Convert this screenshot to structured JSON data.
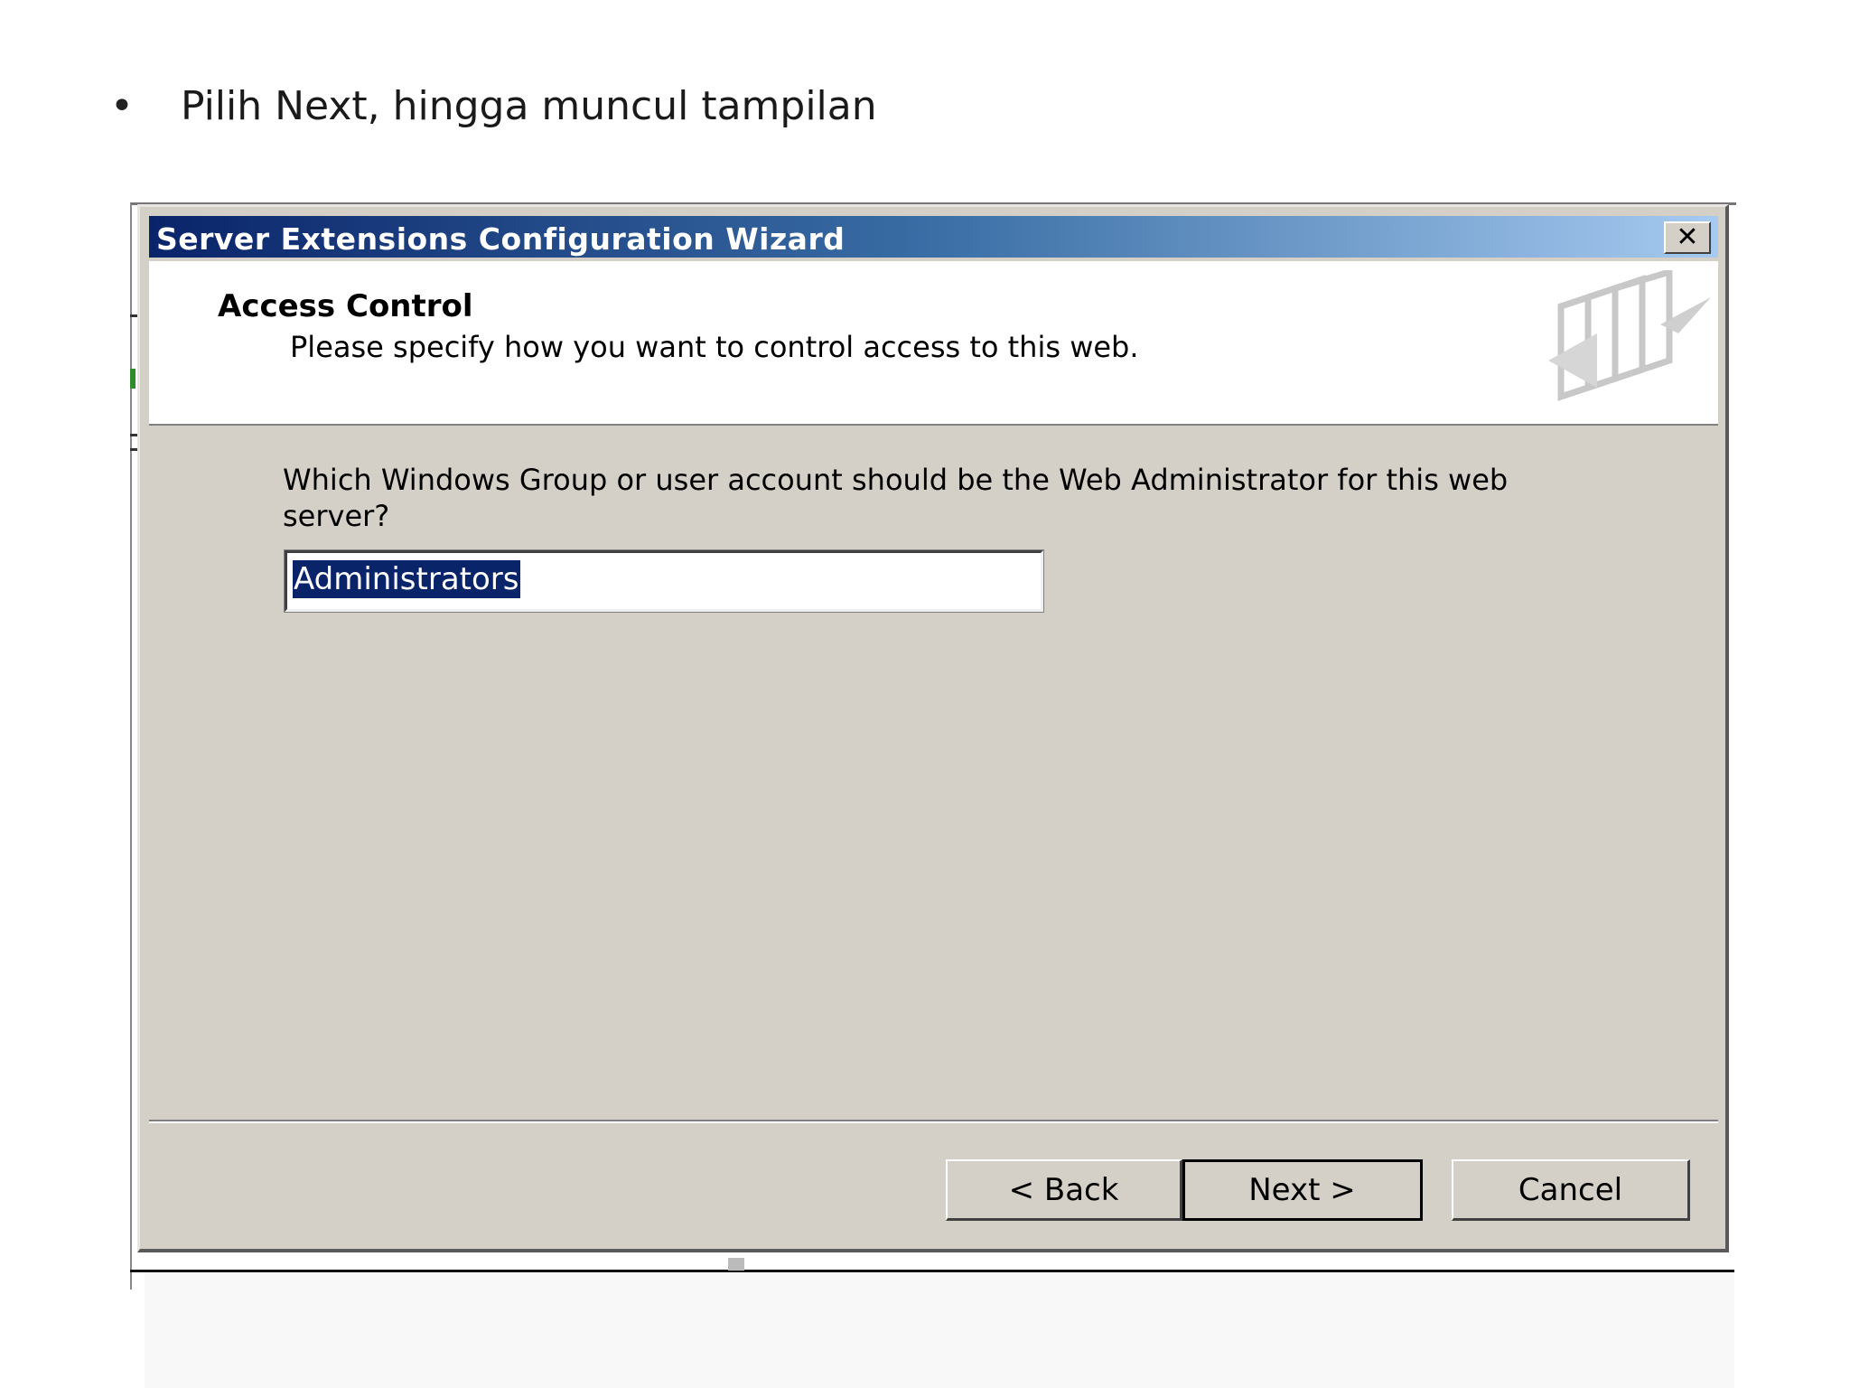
{
  "slide": {
    "bullet": "•",
    "instruction": "Pilih Next, hingga muncul tampilan"
  },
  "dialog": {
    "title": "Server Extensions Configuration Wizard",
    "close_label": "✕",
    "header": {
      "title": "Access Control",
      "subtitle": "Please specify how you want to control access to this web."
    },
    "question": "Which Windows Group or user account should be the Web Administrator for this web server?",
    "admin_field": {
      "value": "Administrators",
      "selected": true
    },
    "buttons": {
      "back": "< Back",
      "next": "Next >",
      "cancel": "Cancel"
    },
    "icons": {
      "close": "close-icon",
      "wizard": "wizard-pages-icon"
    },
    "colors": {
      "title_bar_start": "#0a246a",
      "title_bar_end": "#a6caf0",
      "face": "#d4d0c8",
      "selection": "#0a246a"
    }
  }
}
